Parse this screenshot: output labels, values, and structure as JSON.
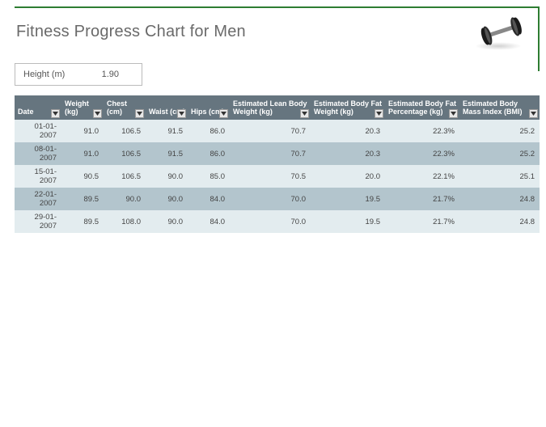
{
  "title": "Fitness Progress Chart for Men",
  "height_field": {
    "label": "Height (m)",
    "value": "1.90"
  },
  "columns": [
    {
      "label": "Date"
    },
    {
      "label": "Weight (kg)"
    },
    {
      "label": "Chest (cm)"
    },
    {
      "label": "Waist (cm)"
    },
    {
      "label": "Hips (cm)"
    },
    {
      "label": "Estimated Lean Body Weight (kg)"
    },
    {
      "label": "Estimated Body Fat Weight (kg)"
    },
    {
      "label": "Estimated Body Fat Percentage (kg)"
    },
    {
      "label": "Estimated Body Mass Index (BMI)"
    }
  ],
  "rows": [
    {
      "date": "01-01-2007",
      "weight": "91.0",
      "chest": "106.5",
      "waist": "91.5",
      "hips": "86.0",
      "lbw": "70.7",
      "bfw": "20.3",
      "bfp": "22.3%",
      "bmi": "25.2"
    },
    {
      "date": "08-01-2007",
      "weight": "91.0",
      "chest": "106.5",
      "waist": "91.5",
      "hips": "86.0",
      "lbw": "70.7",
      "bfw": "20.3",
      "bfp": "22.3%",
      "bmi": "25.2"
    },
    {
      "date": "15-01-2007",
      "weight": "90.5",
      "chest": "106.5",
      "waist": "90.0",
      "hips": "85.0",
      "lbw": "70.5",
      "bfw": "20.0",
      "bfp": "22.1%",
      "bmi": "25.1"
    },
    {
      "date": "22-01-2007",
      "weight": "89.5",
      "chest": "90.0",
      "waist": "90.0",
      "hips": "84.0",
      "lbw": "70.0",
      "bfw": "19.5",
      "bfp": "21.7%",
      "bmi": "24.8"
    },
    {
      "date": "29-01-2007",
      "weight": "89.5",
      "chest": "108.0",
      "waist": "90.0",
      "hips": "84.0",
      "lbw": "70.0",
      "bfw": "19.5",
      "bfp": "21.7%",
      "bmi": "24.8"
    }
  ]
}
